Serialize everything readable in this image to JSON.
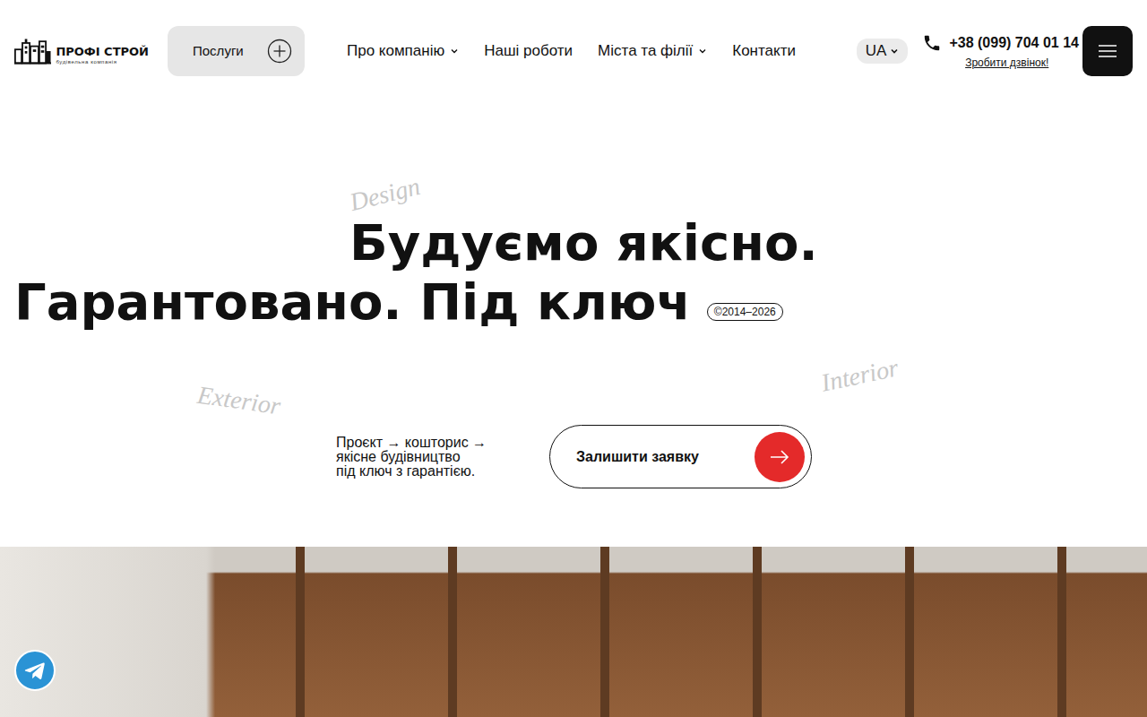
{
  "logo": {
    "name": "ПРОФІ СТРОЙ",
    "tagline": "будівельна компанія"
  },
  "services": {
    "label": "Послуги"
  },
  "nav": [
    {
      "label": "Про компанію",
      "dropdown": true
    },
    {
      "label": "Наші роботи",
      "dropdown": false
    },
    {
      "label": "Міста та філії",
      "dropdown": true
    },
    {
      "label": "Контакти",
      "dropdown": false
    }
  ],
  "language": {
    "label": "UA"
  },
  "phone": {
    "number": "+38 (099) 704 01 14",
    "action": "Зробити дзвінок!"
  },
  "hero": {
    "lines": [
      "Будуємо якісно.",
      "Гарантовано. Під ключ"
    ],
    "badge": "©2014–2026",
    "scriptWords": [
      "Design",
      "Exterior",
      "Interior"
    ],
    "lead": [
      "Проєкт → кошторис →",
      "якісне будівництво",
      "під ключ з гарантією."
    ],
    "cta": "Залишити заявку"
  }
}
